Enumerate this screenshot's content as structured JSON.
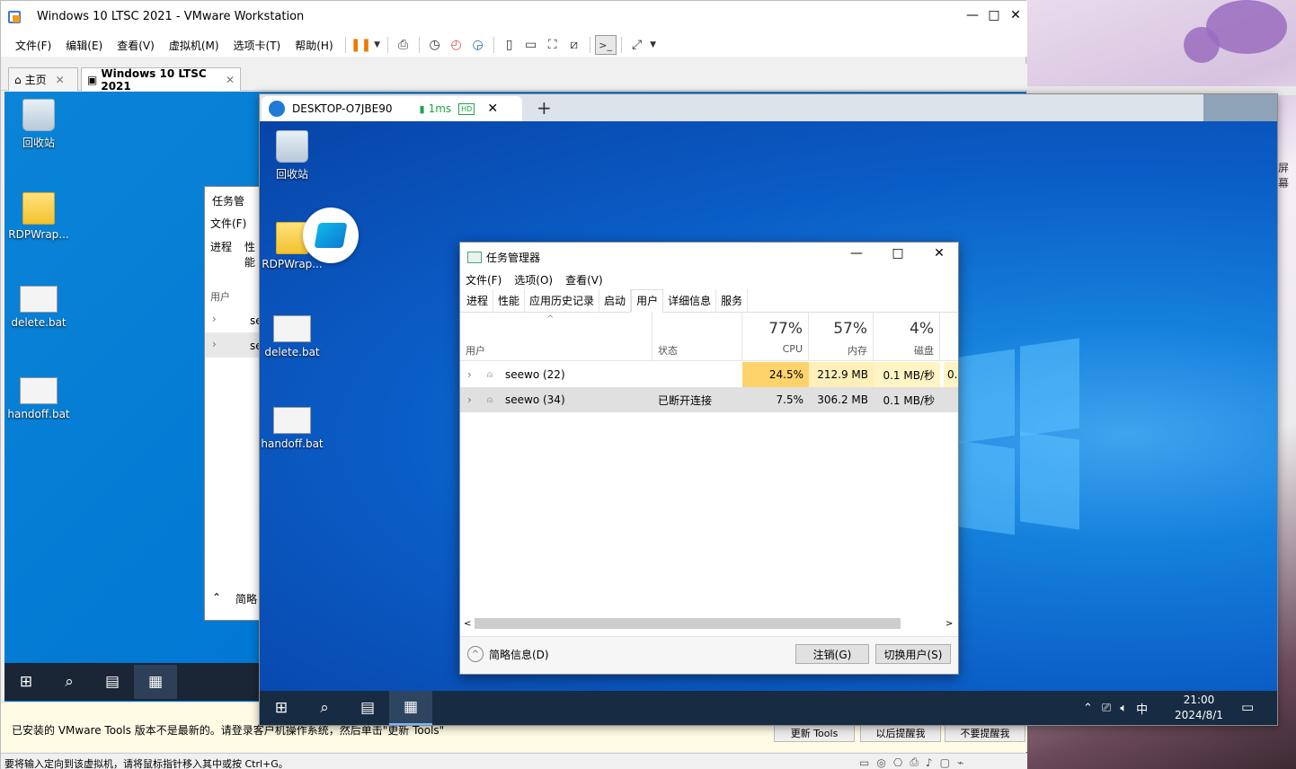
{
  "vmware": {
    "title": "Windows 10 LTSC 2021 - VMware Workstation",
    "window_controls": [
      "—",
      "□",
      "✕"
    ],
    "menu": [
      "文件(F)",
      "编辑(E)",
      "查看(V)",
      "虚拟机(M)",
      "选项卡(T)",
      "帮助(H)"
    ],
    "tabs": [
      {
        "label": "主页"
      },
      {
        "label": "Windows 10 LTSC 2021"
      }
    ],
    "status_message": "已安装的 VMware Tools 版本不是最新的。请登录客户机操作系统，然后单击\"更新 Tools\"",
    "status_buttons": [
      "更新 Tools",
      "以后提醒我",
      "不要提醒我"
    ],
    "bottom_message": "要将输入定向到该虚拟机，请将鼠标指针移入其中或按 Ctrl+G。"
  },
  "guest_desktop": {
    "icons": [
      "回收站",
      "RDPWrap...",
      "delete.bat",
      "handoff.bat"
    ],
    "taskmgr_partial": {
      "title": "任务管",
      "menu": "文件(F)",
      "tabs": [
        "进程",
        "性能"
      ],
      "column": "用户",
      "rows": [
        "se",
        "se"
      ],
      "footer": "简略"
    }
  },
  "rdp": {
    "tab_title": "DESKTOP-O7JBE90",
    "latency": "1ms",
    "hd_badge": "HD",
    "new_tab": "+",
    "window_controls": [
      "—",
      "□",
      "✕"
    ],
    "desktop_icons": [
      "回收站",
      "RDPWrap...",
      "delete.bat",
      "handoff.bat"
    ],
    "taskbar": {
      "time": "21:00",
      "date": "2024/8/1",
      "ime": "中",
      "right_edge_text": "屏幕"
    }
  },
  "task_manager": {
    "title": "任务管理器",
    "menu": [
      "文件(F)",
      "选项(O)",
      "查看(V)"
    ],
    "tabs": [
      "进程",
      "性能",
      "应用历史记录",
      "启动",
      "用户",
      "详细信息",
      "服务"
    ],
    "active_tab": "用户",
    "columns": {
      "user": "用户",
      "status": "状态",
      "cpu_pct": "77%",
      "cpu": "CPU",
      "mem_pct": "57%",
      "mem": "内存",
      "disk_pct": "4%",
      "disk": "磁盘"
    },
    "rows": [
      {
        "user": "seewo (22)",
        "status": "",
        "cpu": "24.5%",
        "mem": "212.9 MB",
        "disk": "0.1 MB/秒",
        "net": "0."
      },
      {
        "user": "seewo (34)",
        "status": "已断开连接",
        "cpu": "7.5%",
        "mem": "306.2 MB",
        "disk": "0.1 MB/秒",
        "net": ""
      }
    ],
    "footer": {
      "brief": "简略信息(D)",
      "logout": "注销(G)",
      "switch_user": "切换用户(S)"
    }
  }
}
